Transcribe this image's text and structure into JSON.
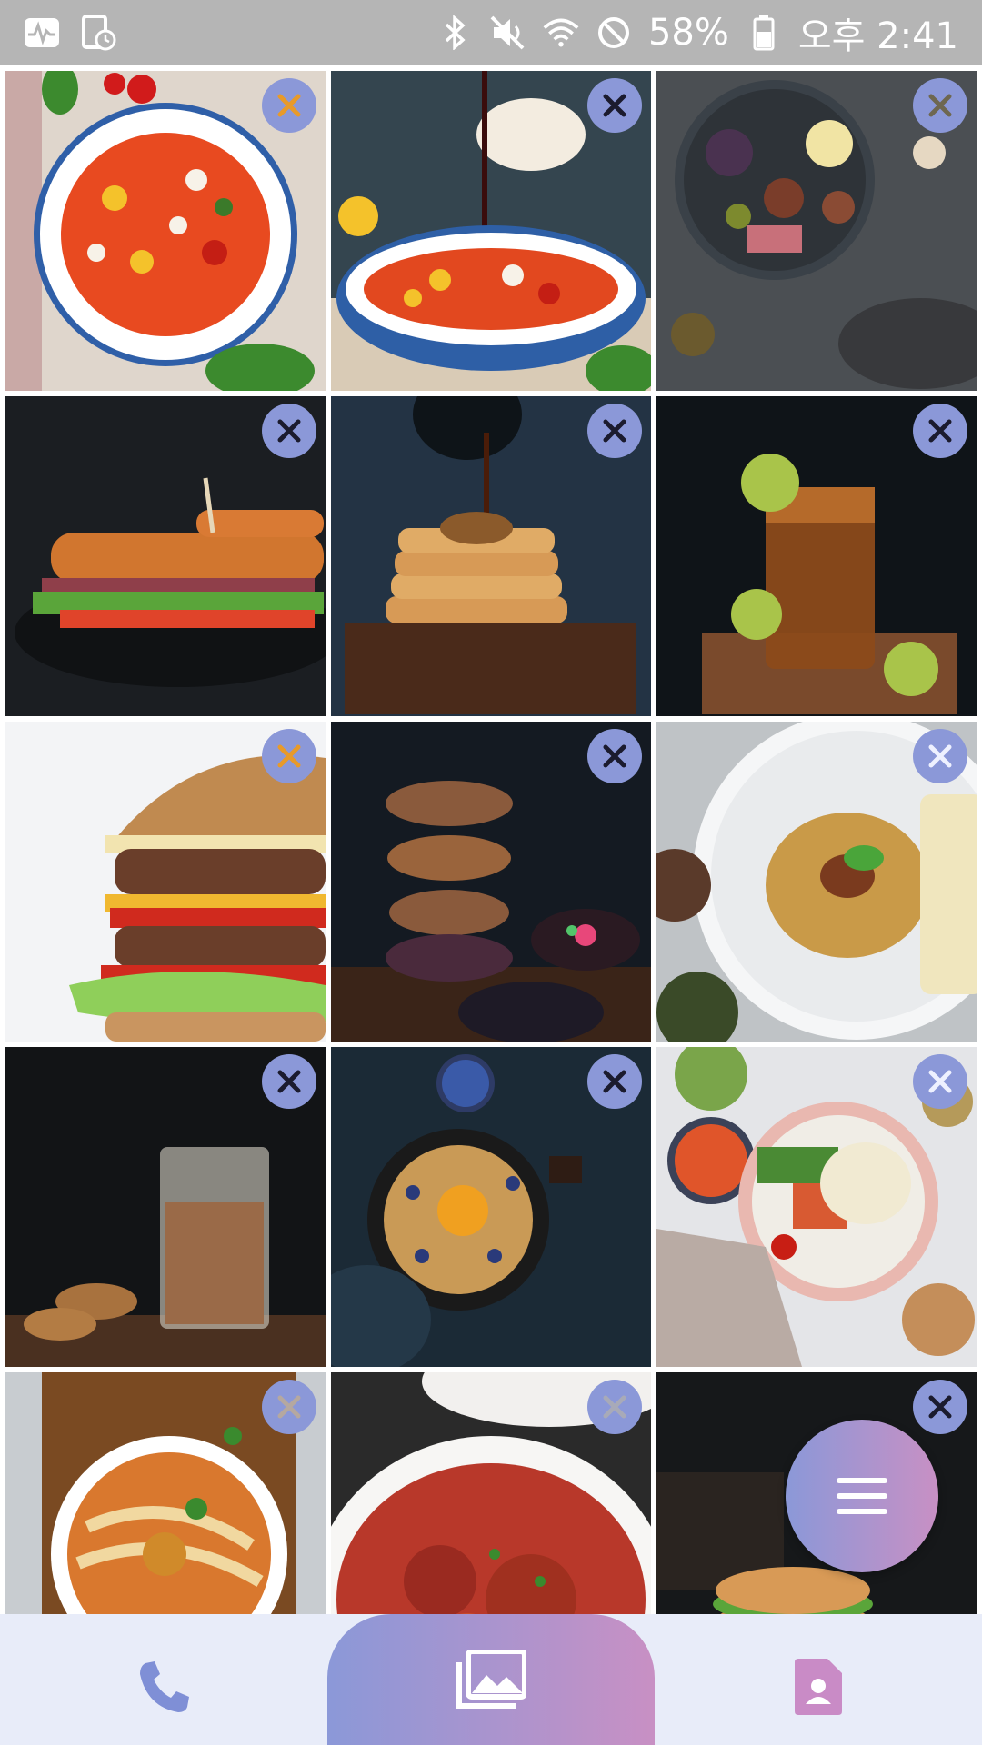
{
  "status_bar": {
    "battery": "58%",
    "time": "오후 2:41",
    "icons": [
      "activity-monitor-icon",
      "device-clock-icon",
      "bluetooth-icon",
      "mute-icon",
      "wifi-icon",
      "do-not-disturb-icon",
      "battery-icon"
    ]
  },
  "gallery": {
    "tiles": [
      {
        "name": "tomato-salad-topdown",
        "dark": false
      },
      {
        "name": "tomato-salad-pour",
        "dark": false
      },
      {
        "name": "platter-figs-eggs",
        "dark": true
      },
      {
        "name": "sandwich",
        "dark": true
      },
      {
        "name": "pancakes-syrup",
        "dark": true
      },
      {
        "name": "iced-tea",
        "dark": true
      },
      {
        "name": "burger-white",
        "dark": false
      },
      {
        "name": "donut-stack",
        "dark": true
      },
      {
        "name": "spaghetti-plate",
        "dark": false
      },
      {
        "name": "iced-coffee-cookies",
        "dark": true
      },
      {
        "name": "skillet-pancake",
        "dark": true
      },
      {
        "name": "salmon-bowl",
        "dark": false
      },
      {
        "name": "noodle-soup",
        "dark": false
      },
      {
        "name": "meatball-pasta",
        "dark": false
      },
      {
        "name": "burgers-dark",
        "dark": true
      }
    ],
    "remove_icon": "close-icon"
  },
  "fab": {
    "icon": "menu-icon"
  },
  "bottom_nav": {
    "items": [
      {
        "icon": "phone-icon",
        "active": false
      },
      {
        "icon": "gallery-icon",
        "active": true
      },
      {
        "icon": "contact-icon",
        "active": false
      }
    ],
    "accent_start": "#8b98d8",
    "accent_end": "#c890c4"
  }
}
